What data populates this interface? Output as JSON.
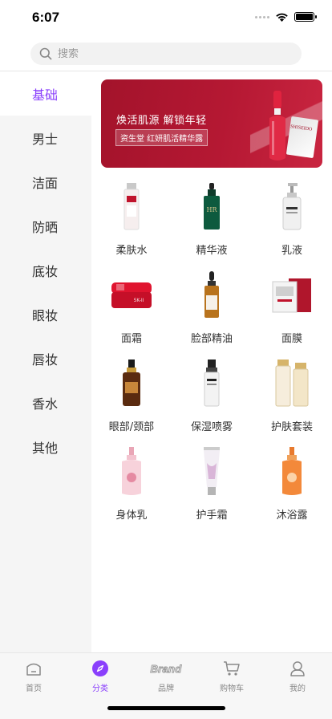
{
  "status_bar": {
    "time": "6:07"
  },
  "search": {
    "placeholder": "搜索"
  },
  "sidebar": {
    "items": [
      {
        "label": "基础",
        "active": true
      },
      {
        "label": "男士"
      },
      {
        "label": "洁面"
      },
      {
        "label": "防晒"
      },
      {
        "label": "底妆"
      },
      {
        "label": "眼妆"
      },
      {
        "label": "唇妆"
      },
      {
        "label": "香水"
      },
      {
        "label": "其他"
      }
    ]
  },
  "banner": {
    "title": "焕活肌源 解锁年轻",
    "subtitle": "资生堂 红妍肌活精华露",
    "brand": "SHISEIDO"
  },
  "categories": [
    {
      "label": "柔肤水",
      "icon": "toner-bottle-icon"
    },
    {
      "label": "精华液",
      "icon": "serum-bottle-icon"
    },
    {
      "label": "乳液",
      "icon": "lotion-pump-icon"
    },
    {
      "label": "面霜",
      "icon": "cream-jar-icon"
    },
    {
      "label": "脸部精油",
      "icon": "face-oil-dropper-icon"
    },
    {
      "label": "面膜",
      "icon": "face-mask-pack-icon"
    },
    {
      "label": "眼部/颈部",
      "icon": "eye-serum-bottle-icon"
    },
    {
      "label": "保湿喷雾",
      "icon": "mist-spray-icon"
    },
    {
      "label": "护肤套装",
      "icon": "skincare-set-icon"
    },
    {
      "label": "身体乳",
      "icon": "body-lotion-bottle-icon"
    },
    {
      "label": "护手霜",
      "icon": "hand-cream-tube-icon"
    },
    {
      "label": "沐浴露",
      "icon": "shower-gel-bottle-icon"
    }
  ],
  "tab_bar": {
    "tabs": [
      {
        "label": "首页",
        "icon": "home-icon"
      },
      {
        "label": "分类",
        "icon": "category-compass-icon",
        "active": true
      },
      {
        "label": "品牌",
        "icon": "brand-icon",
        "icon_text": "Brand"
      },
      {
        "label": "购物车",
        "icon": "cart-icon"
      },
      {
        "label": "我的",
        "icon": "profile-icon"
      }
    ]
  },
  "colors": {
    "accent": "#8a3ffc",
    "sidebar_bg": "#f5f5f5",
    "banner_red": "#a3132b"
  }
}
